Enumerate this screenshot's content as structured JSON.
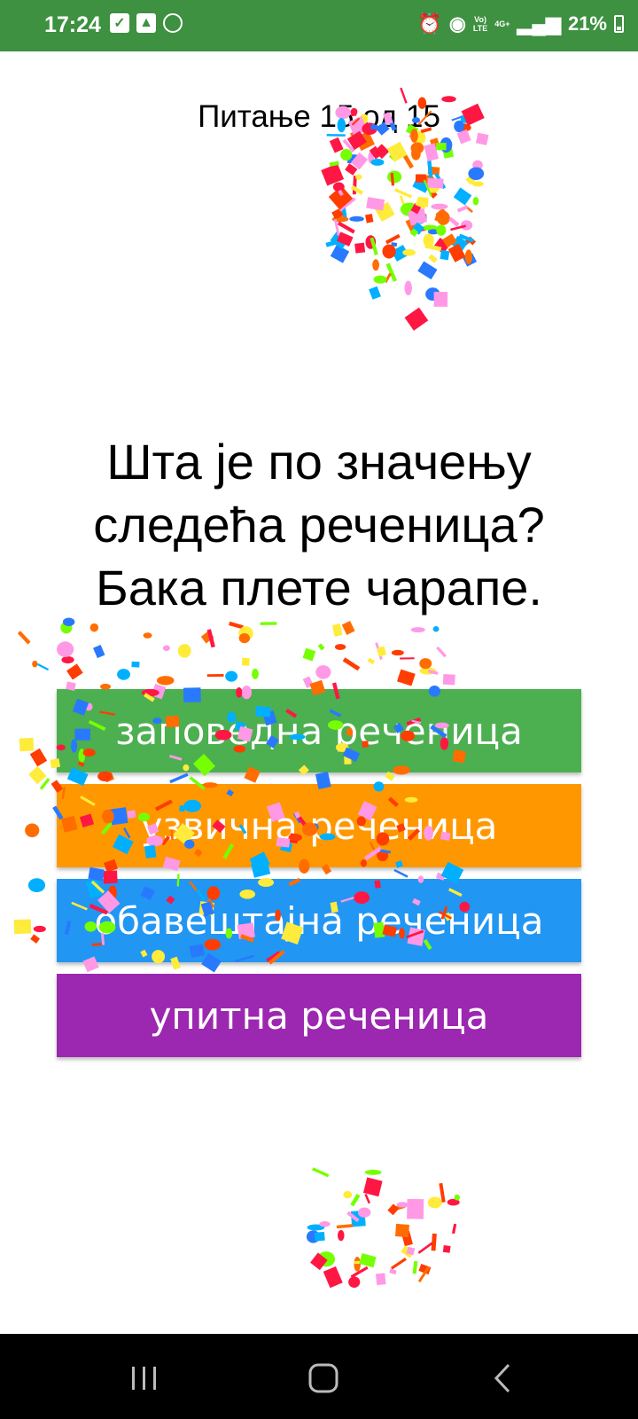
{
  "status_bar": {
    "time": "17:24",
    "volte_top": "Vo)",
    "volte_bottom": "LTE",
    "network": "4G+",
    "battery": "21%"
  },
  "quiz": {
    "counter": "Питање 15 од 15",
    "question": "Шта је по значењу следећа реченица? Бака плете чарапе.",
    "answers": [
      {
        "label": "заповедна реченица",
        "color": "#4caf50"
      },
      {
        "label": "узвична реченица",
        "color": "#ff9800"
      },
      {
        "label": "обавештајна реченица",
        "color": "#2196f3"
      },
      {
        "label": "упитна реченица",
        "color": "#9c27b0"
      }
    ]
  },
  "colors": {
    "status_bar": "#3d9140",
    "confetti": [
      "#ff1744",
      "#ffeb3b",
      "#2979ff",
      "#76ff03",
      "#ff6d00",
      "#ff99e6",
      "#00b0ff",
      "#ff3d00"
    ]
  },
  "nav": {
    "recent_icon": "recent-apps-icon",
    "home_icon": "home-icon",
    "back_icon": "back-icon"
  }
}
